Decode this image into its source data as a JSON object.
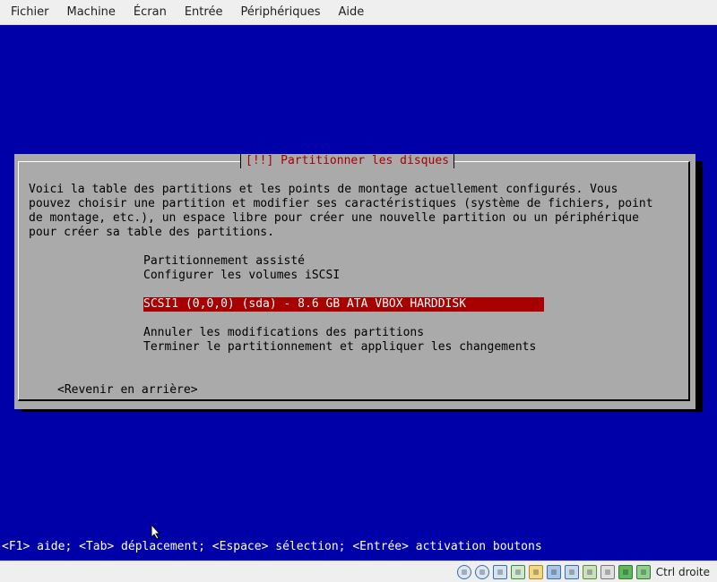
{
  "menubar": {
    "items": [
      "Fichier",
      "Machine",
      "Écran",
      "Entrée",
      "Périphériques",
      "Aide"
    ]
  },
  "dialog": {
    "title": "[!!] Partitionner les disques",
    "text_lines": [
      "Voici la table des partitions et les points de montage actuellement configurés. Vous",
      "pouvez choisir une partition et modifier ses caractéristiques (système de fichiers, point",
      "de montage, etc.), un espace libre pour créer une nouvelle partition ou un périphérique",
      "pour créer sa table des partitions."
    ],
    "options": [
      "Partitionnement assisté",
      "Configurer les volumes iSCSI",
      "SCSI1 (0,0,0) (sda) - 8.6 GB ATA VBOX HARDDISK",
      "Annuler les modifications des partitions",
      "Terminer le partitionnement et appliquer les changements"
    ],
    "selected_index": 2,
    "back_button": "<Revenir en arrière>"
  },
  "status_line": "<F1> aide; <Tab> déplacement; <Espace> sélection; <Entrée> activation boutons",
  "hostbar": {
    "icons": [
      "optical-drive-icon",
      "hard-disk-icon",
      "audio-icon",
      "network-icon",
      "shared-folders-icon",
      "display-icon",
      "video-capture-icon",
      "cpu-icon",
      "usb-icon",
      "mouse-integration-icon",
      "keyboard-capture-icon"
    ],
    "host_key_label": "Ctrl droite"
  },
  "colors": {
    "screen_bg": "#0000a8",
    "dialog_bg": "#aaaaaa",
    "title_fg": "#a80000",
    "selection_bg": "#a80000"
  }
}
